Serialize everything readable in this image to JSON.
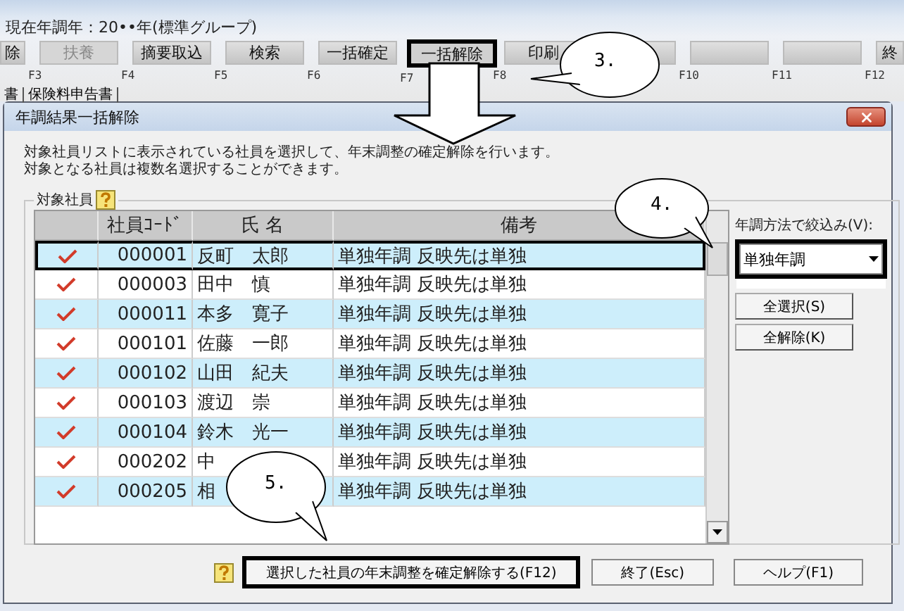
{
  "header": {
    "year_label": "現在年調年：20••年(標準グループ)"
  },
  "toolbar": [
    {
      "label": "除",
      "disabled": false,
      "highlighted": false
    },
    {
      "label": "扶養",
      "fkey": "F3",
      "disabled": true,
      "highlighted": false
    },
    {
      "label": "摘要取込",
      "fkey": "F4",
      "disabled": false,
      "highlighted": false
    },
    {
      "label": "検索",
      "fkey": "F5",
      "disabled": false,
      "highlighted": false
    },
    {
      "label": "一括確定",
      "fkey": "F6",
      "disabled": false,
      "highlighted": false
    },
    {
      "label": "一括解除",
      "fkey": "F7",
      "disabled": false,
      "highlighted": true
    },
    {
      "label": "印刷",
      "fkey": "F8",
      "disabled": false,
      "highlighted": false
    },
    {
      "disabled": false,
      "highlighted": false
    },
    {
      "fkey": "F10",
      "disabled": false,
      "highlighted": false
    },
    {
      "fkey": "F11",
      "disabled": false,
      "highlighted": false
    },
    {
      "label": "終",
      "fkey": "F12",
      "disabled": false,
      "highlighted": false
    }
  ],
  "tabs": [
    {
      "label": "書",
      "selected": false
    },
    {
      "label": "保険料申告書",
      "selected": false
    }
  ],
  "dialog": {
    "title": "年調結果一括解除",
    "description": [
      "対象社員リストに表示されている社員を選択して、年末調整の確定解除を行います。",
      "対象となる社員は複数名選択することができます。"
    ],
    "group_label": "対象社員",
    "table": {
      "columns": [
        "社員ｺｰﾄﾞ",
        "氏 名",
        "備考"
      ],
      "rows": [
        {
          "code": "000001",
          "name": "反町　太郎",
          "remarks": "単独年調 反映先は単独",
          "checked": true,
          "selected": true
        },
        {
          "code": "000003",
          "name": "田中　慎",
          "remarks": "単独年調 反映先は単独",
          "checked": true,
          "selected": false
        },
        {
          "code": "000011",
          "name": "本多　寛子",
          "remarks": "単独年調 反映先は単独",
          "checked": true,
          "selected": false
        },
        {
          "code": "000101",
          "name": "佐藤　一郎",
          "remarks": "単独年調 反映先は単独",
          "checked": true,
          "selected": false
        },
        {
          "code": "000102",
          "name": "山田　紀夫",
          "remarks": "単独年調 反映先は単独",
          "checked": true,
          "selected": false
        },
        {
          "code": "000103",
          "name": "渡辺　崇",
          "remarks": "単独年調 反映先は単独",
          "checked": true,
          "selected": false
        },
        {
          "code": "000104",
          "name": "鈴木　光一",
          "remarks": "単独年調 反映先は単独",
          "checked": true,
          "selected": false
        },
        {
          "code": "000202",
          "name": "中",
          "remarks": "単独年調 反映先は単独",
          "checked": true,
          "selected": false
        },
        {
          "code": "000205",
          "name": "相",
          "remarks": "単独年調 反映先は単独",
          "checked": true,
          "selected": false
        }
      ]
    },
    "filter": {
      "label": "年調方法で絞込み(V):",
      "value": "単独年調",
      "highlighted": true
    },
    "side_buttons": [
      "全選択(S)",
      "全解除(K)"
    ],
    "footer_buttons": [
      {
        "label": "選択した社員の年末調整を確定解除する(F12)",
        "highlighted": true
      },
      {
        "label": "終了(Esc)",
        "highlighted": false
      },
      {
        "label": "ヘルプ(F1)",
        "highlighted": false
      }
    ]
  },
  "callouts": [
    {
      "label": "3."
    },
    {
      "label": "4."
    },
    {
      "label": "5."
    }
  ]
}
